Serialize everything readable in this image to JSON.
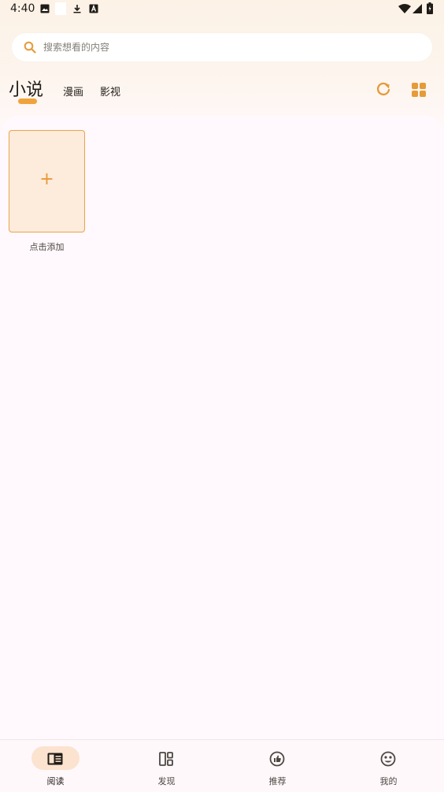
{
  "status_bar": {
    "time": "4:40",
    "icons": [
      "image-icon",
      "download-icon",
      "a-badge-icon",
      "wifi-icon",
      "signal-icon",
      "battery-icon"
    ]
  },
  "search": {
    "placeholder": "搜索想看的内容",
    "value": ""
  },
  "tabs": [
    {
      "label": "小说",
      "active": true
    },
    {
      "label": "漫画",
      "active": false
    },
    {
      "label": "影视",
      "active": false
    }
  ],
  "toolbar": {
    "icons": [
      "refresh-icon",
      "grid-view-icon"
    ]
  },
  "library": {
    "add_card_symbol": "+",
    "add_label": "点击添加"
  },
  "bottom_nav": [
    {
      "label": "阅读",
      "icon": "book-icon",
      "active": true
    },
    {
      "label": "发现",
      "icon": "discover-icon",
      "active": false
    },
    {
      "label": "推荐",
      "icon": "thumb-up-icon",
      "active": false
    },
    {
      "label": "我的",
      "icon": "profile-icon",
      "active": false
    }
  ],
  "colors": {
    "accent": "#f0a33c",
    "card_fill": "#fdebdb",
    "nav_pill": "#fbe3cf",
    "background": "#fff8fc"
  }
}
